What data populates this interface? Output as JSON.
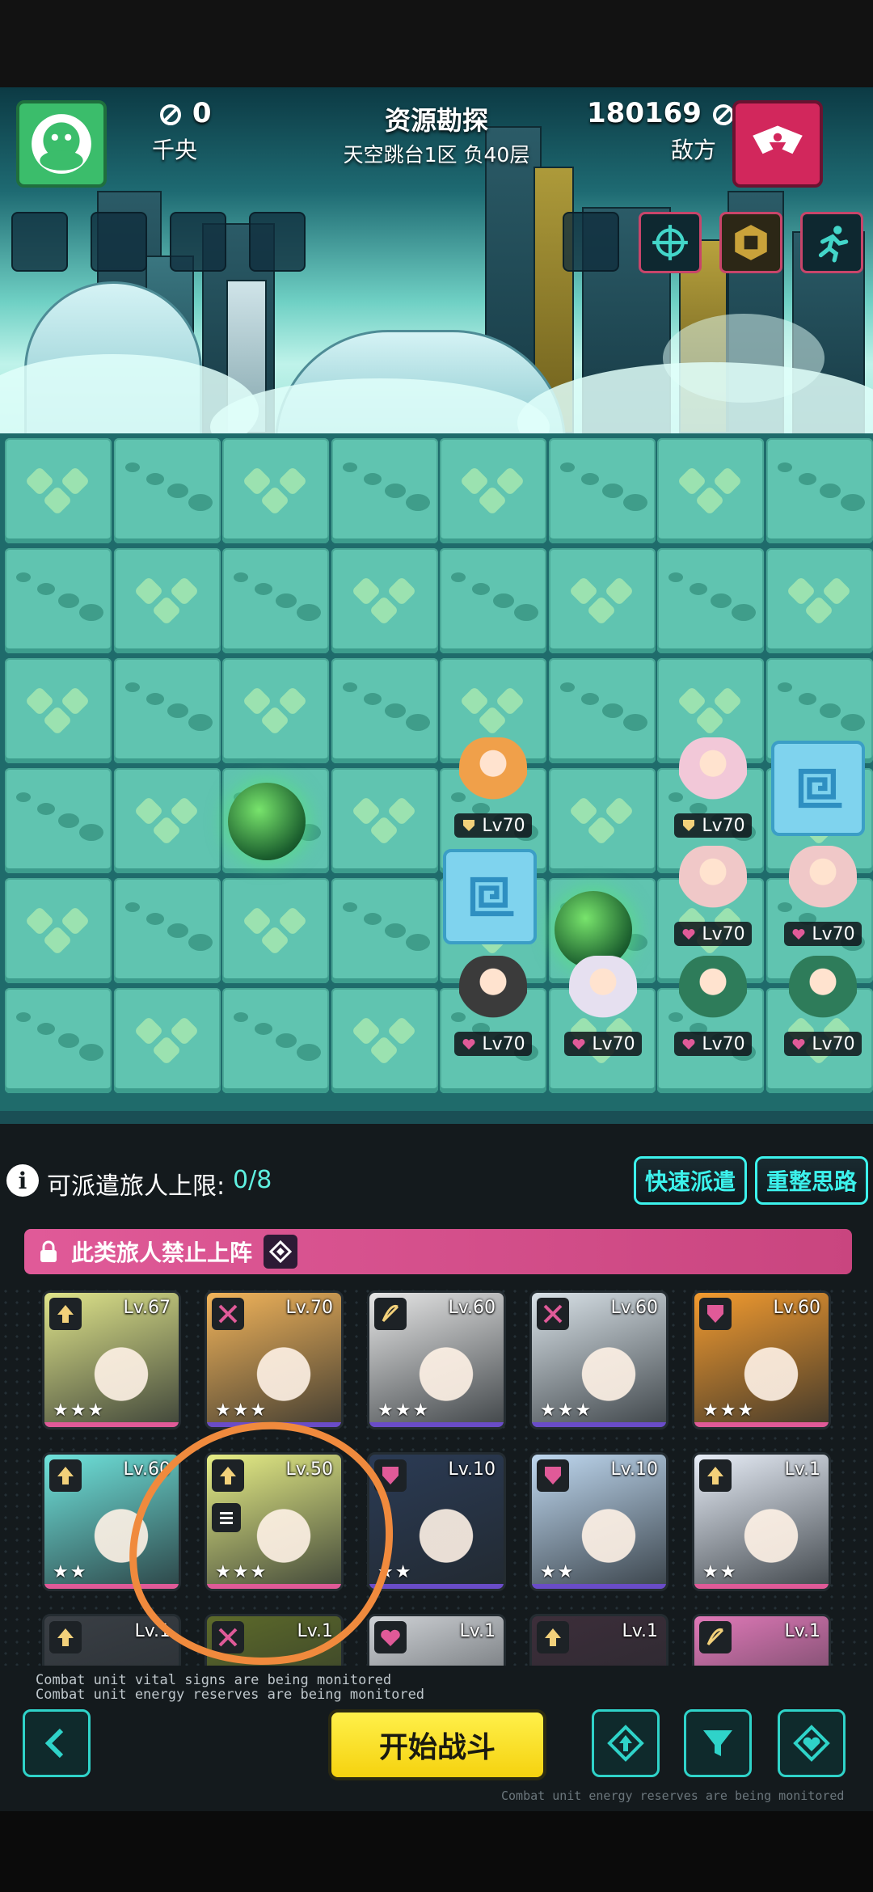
{
  "header": {
    "title": "资源勘探",
    "subtitle": "天空跳台1区 负40层",
    "player": {
      "score": "0",
      "name": "千央"
    },
    "enemy": {
      "score": "180169",
      "name": "敌方"
    },
    "colors": {
      "player": "#3bbd6b",
      "enemy": "#d2275c"
    },
    "skills": [
      "crosshair-icon",
      "hex-shield-icon",
      "runner-icon"
    ]
  },
  "board": {
    "units": [
      {
        "level": "Lv70",
        "cls": "shield-icon"
      },
      {
        "level": "Lv70",
        "cls": "heart-icon"
      },
      {
        "level": "Lv70",
        "cls": "shield-icon"
      },
      {
        "level": "Lv70",
        "cls": "heart-icon"
      },
      {
        "level": "Lv70",
        "cls": "heart-icon"
      },
      {
        "level": "Lv70",
        "cls": "heart-icon"
      },
      {
        "level": "Lv70",
        "cls": "heart-icon"
      },
      {
        "level": "Lv70",
        "cls": "heart-icon"
      }
    ]
  },
  "panel": {
    "limit_label": "可派遣旅人上限:",
    "limit_value": "0/8",
    "quick_dispatch": "快速派遣",
    "reset": "重整思路",
    "banner": "此类旅人禁止上阵",
    "start": "开始战斗"
  },
  "roster": [
    {
      "level": "Lv.67",
      "cls": "arrow-up-icon",
      "stars": "★★★",
      "color": "#dfe48a"
    },
    {
      "level": "Lv.70",
      "cls": "crossed-swords-icon",
      "stars": "★★★",
      "color": "#f2b45a"
    },
    {
      "level": "Lv.60",
      "cls": "bow-icon",
      "stars": "★★★",
      "color": "#e6e6e6"
    },
    {
      "level": "Lv.60",
      "cls": "crossed-swords-icon",
      "stars": "★★★",
      "color": "#d9e2e8"
    },
    {
      "level": "Lv.60",
      "cls": "shield-icon",
      "stars": "★★★",
      "color": "#f39b2f"
    },
    {
      "level": "Lv.60",
      "cls": "arrow-up-icon",
      "stars": "★★",
      "color": "#6fe3dc"
    },
    {
      "level": "Lv.50",
      "cls": "arrow-up-icon",
      "stars": "★★★",
      "color": "#e7ee86"
    },
    {
      "level": "Lv.10",
      "cls": "shield-icon",
      "stars": "★★",
      "color": "#2b3b55"
    },
    {
      "level": "Lv.10",
      "cls": "shield-icon",
      "stars": "★★",
      "color": "#bfd8f0"
    },
    {
      "level": "Lv.1",
      "cls": "arrow-up-icon",
      "stars": "★★",
      "color": "#e8eef8"
    },
    {
      "level": "Lv.1",
      "cls": "arrow-up-icon",
      "stars": "",
      "color": "#3a3f45"
    },
    {
      "level": "Lv.1",
      "cls": "crossed-swords-icon",
      "stars": "",
      "color": "#5d6a2a"
    },
    {
      "level": "Lv.1",
      "cls": "heart-icon",
      "stars": "",
      "color": "#cfd2d6"
    },
    {
      "level": "Lv.1",
      "cls": "arrow-up-icon",
      "stars": "",
      "color": "#3d2e3a"
    },
    {
      "level": "Lv.1",
      "cls": "bow-icon",
      "stars": "",
      "color": "#e079b8"
    }
  ],
  "console": {
    "line1": "Combat unit vital signs are being monitored",
    "line2": "Combat unit energy reserves are being monitored",
    "line3": "Combat unit energy reserves are being monitored"
  }
}
